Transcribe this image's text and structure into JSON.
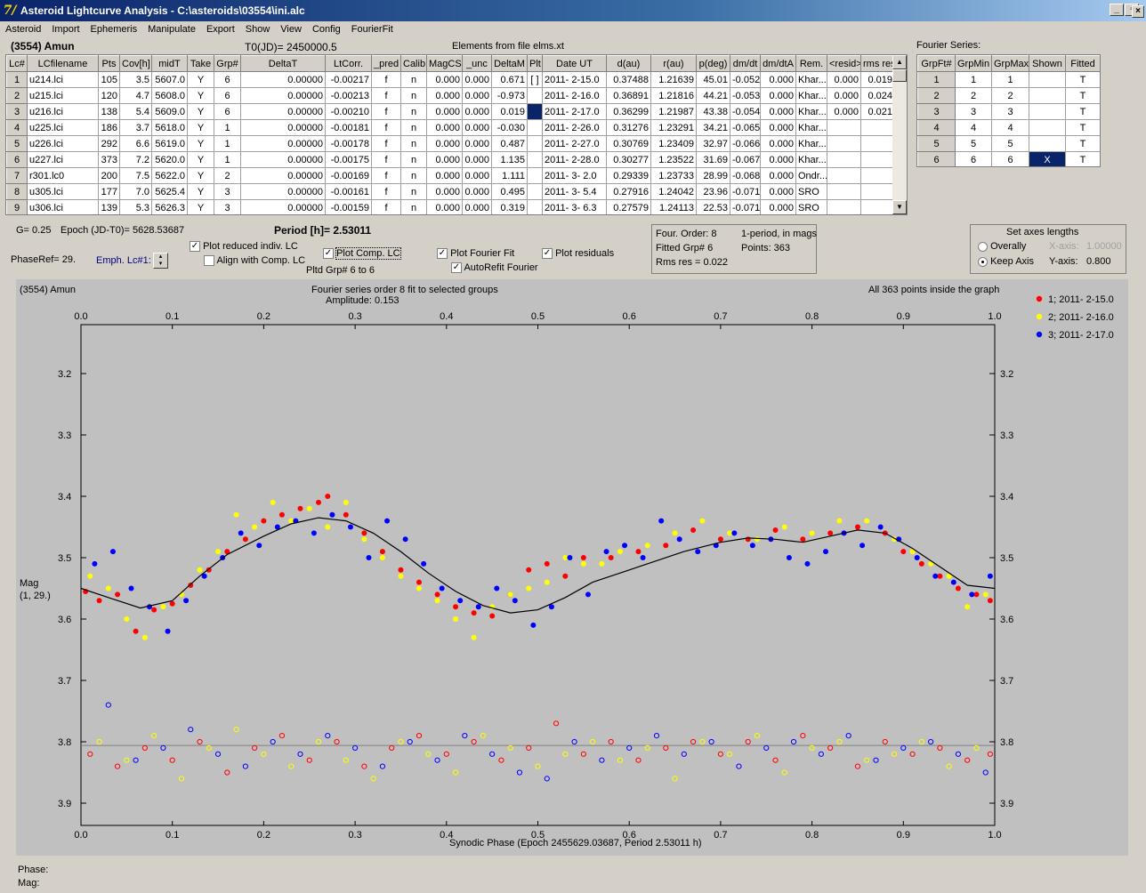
{
  "window": {
    "title": "Asteroid Lightcurve Analysis - C:\\asteroids\\03554\\ini.alc",
    "icon": "app-logo-icon",
    "controls": [
      "minimize-icon",
      "restore-icon",
      "close-icon"
    ]
  },
  "menu": [
    "Asteroid",
    "Import",
    "Ephemeris",
    "Manipulate",
    "Export",
    "Show",
    "View",
    "Config",
    "FourierFit"
  ],
  "header": {
    "asteroid": "(3554) Amun",
    "t0": "T0(JD)= 2450000.5",
    "elements": "Elements from file elms.xt"
  },
  "lc_table": {
    "columns": [
      "Lc#",
      "LCfilename",
      "Pts",
      "Cov[h]",
      "midT",
      "Take",
      "Grp#",
      "DeltaT",
      "LtCorr.",
      "_pred",
      "Calib.",
      "MagCS",
      "_unc",
      "DeltaM",
      "Plt",
      "Date UT",
      "d(au)",
      "r(au)",
      "p(deg)",
      "dm/dt",
      "dm/dtA",
      "Rem.",
      "<resid>",
      "rms res"
    ],
    "rows": [
      [
        "1",
        "u214.lci",
        "105",
        "3.5",
        "5607.0",
        "Y",
        "6",
        "0.00000",
        "-0.00217",
        "f",
        "n",
        "0.000",
        "0.000",
        "0.671",
        "[ ]",
        "2011- 2-15.0",
        "0.37488",
        "1.21639",
        "45.01",
        "-0.052",
        "0.000",
        "Khar...",
        "0.000",
        "0.019"
      ],
      [
        "2",
        "u215.lci",
        "120",
        "4.7",
        "5608.0",
        "Y",
        "6",
        "0.00000",
        "-0.00213",
        "f",
        "n",
        "0.000",
        "0.000",
        "-0.973",
        "",
        "2011- 2-16.0",
        "0.36891",
        "1.21816",
        "44.21",
        "-0.053",
        "0.000",
        "Khar...",
        "0.000",
        "0.024"
      ],
      [
        "3",
        "u216.lci",
        "138",
        "5.4",
        "5609.0",
        "Y",
        "6",
        "0.00000",
        "-0.00210",
        "f",
        "n",
        "0.000",
        "0.000",
        "0.019",
        "",
        "2011- 2-17.0",
        "0.36299",
        "1.21987",
        "43.38",
        "-0.054",
        "0.000",
        "Khar...",
        "0.000",
        "0.021"
      ],
      [
        "4",
        "u225.lci",
        "186",
        "3.7",
        "5618.0",
        "Y",
        "1",
        "0.00000",
        "-0.00181",
        "f",
        "n",
        "0.000",
        "0.000",
        "-0.030",
        "",
        "2011- 2-26.0",
        "0.31276",
        "1.23291",
        "34.21",
        "-0.065",
        "0.000",
        "Khar...",
        "",
        ""
      ],
      [
        "5",
        "u226.lci",
        "292",
        "6.6",
        "5619.0",
        "Y",
        "1",
        "0.00000",
        "-0.00178",
        "f",
        "n",
        "0.000",
        "0.000",
        "0.487",
        "",
        "2011- 2-27.0",
        "0.30769",
        "1.23409",
        "32.97",
        "-0.066",
        "0.000",
        "Khar...",
        "",
        ""
      ],
      [
        "6",
        "u227.lci",
        "373",
        "7.2",
        "5620.0",
        "Y",
        "1",
        "0.00000",
        "-0.00175",
        "f",
        "n",
        "0.000",
        "0.000",
        "1.135",
        "",
        "2011- 2-28.0",
        "0.30277",
        "1.23522",
        "31.69",
        "-0.067",
        "0.000",
        "Khar...",
        "",
        ""
      ],
      [
        "7",
        "r301.lc0",
        "200",
        "7.5",
        "5622.0",
        "Y",
        "2",
        "0.00000",
        "-0.00169",
        "f",
        "n",
        "0.000",
        "0.000",
        "1.111",
        "",
        "2011- 3- 2.0",
        "0.29339",
        "1.23733",
        "28.99",
        "-0.068",
        "0.000",
        "Ondr...",
        "",
        ""
      ],
      [
        "8",
        "u305.lci",
        "177",
        "7.0",
        "5625.4",
        "Y",
        "3",
        "0.00000",
        "-0.00161",
        "f",
        "n",
        "0.000",
        "0.000",
        "0.495",
        "",
        "2011- 3- 5.4",
        "0.27916",
        "1.24042",
        "23.96",
        "-0.071",
        "0.000",
        "SRO",
        "",
        ""
      ],
      [
        "9",
        "u306.lci",
        "139",
        "5.3",
        "5626.3",
        "Y",
        "3",
        "0.00000",
        "-0.00159",
        "f",
        "n",
        "0.000",
        "0.000",
        "0.319",
        "",
        "2011- 3- 6.3",
        "0.27579",
        "1.24113",
        "22.53",
        "-0.071",
        "0.000",
        "SRO",
        "",
        ""
      ]
    ],
    "selected_plt_row": 3
  },
  "fourier": {
    "label": "Fourier Series:",
    "columns": [
      "GrpFt#",
      "GrpMin",
      "GrpMax",
      "Shown",
      "Fitted"
    ],
    "rows": [
      [
        "1",
        "1",
        "1",
        "",
        "T"
      ],
      [
        "2",
        "2",
        "2",
        "",
        "T"
      ],
      [
        "3",
        "3",
        "3",
        "",
        "T"
      ],
      [
        "4",
        "4",
        "4",
        "",
        "T"
      ],
      [
        "5",
        "5",
        "5",
        "",
        "T"
      ],
      [
        "6",
        "6",
        "6",
        "X",
        "T"
      ]
    ]
  },
  "params": {
    "g": "G= 0.25",
    "epoch": "Epoch (JD-T0)= 5628.53687",
    "period": "Period [h]= 2.53011",
    "phaseref": "PhaseRef= 29.",
    "emph": "Emph. Lc#1:",
    "pltd": "Pltd Grp#  6  to   6"
  },
  "checks": [
    {
      "id": "plot-reduced",
      "label": "Plot reduced indiv. LC",
      "checked": true
    },
    {
      "id": "align-comp",
      "label": "Align with Comp. LC",
      "checked": false
    },
    {
      "id": "plot-comp",
      "label": "Plot Comp. LC",
      "checked": true
    },
    {
      "id": "plot-fourier",
      "label": "Plot Fourier Fit",
      "checked": true
    },
    {
      "id": "autorefit",
      "label": "AutoRefit Fourier",
      "checked": true
    },
    {
      "id": "plot-resid",
      "label": "Plot residuals",
      "checked": true
    }
  ],
  "info": {
    "order": "Four. Order:  8",
    "fitted": "Fitted Grp# 6",
    "rms": "Rms res     = 0.022",
    "period_note": "1-period, in mags",
    "points": "Points: 363"
  },
  "axes_box": {
    "title": "Set axes lengths",
    "overally": "Overally",
    "keep": "Keep Axis",
    "xaxis_label": "X-axis:",
    "xaxis_val": "1.00000",
    "yaxis_label": "Y-axis:",
    "yaxis_val": "0.800",
    "selected": "keep"
  },
  "chart_data": {
    "type": "scatter",
    "title": "Fourier series order 8 fit to selected groups",
    "subtitle": "Amplitude: 0.153",
    "left_label": "(3554) Amun",
    "right_label": "All 363 points inside the graph",
    "xlabel": "Synodic Phase (Epoch 2455629.03687, Period 2.53011 h)",
    "ylabel": "Mag\n(1, 29.)",
    "xlim": [
      0,
      1
    ],
    "ylim": [
      3.9,
      3.2
    ],
    "y_inverted": true,
    "xticks": [
      "0.0",
      "0.1",
      "0.2",
      "0.3",
      "0.4",
      "0.5",
      "0.6",
      "0.7",
      "0.8",
      "0.9",
      "1.0"
    ],
    "yticks": [
      "3.2",
      "3.3",
      "3.4",
      "3.5",
      "3.6",
      "3.7",
      "3.8",
      "3.9"
    ],
    "residual_baseline": 3.806,
    "fourier_fit": {
      "x": [
        0,
        0.03,
        0.065,
        0.1,
        0.13,
        0.16,
        0.2,
        0.23,
        0.26,
        0.29,
        0.32,
        0.35,
        0.38,
        0.41,
        0.44,
        0.47,
        0.5,
        0.53,
        0.56,
        0.6,
        0.63,
        0.66,
        0.7,
        0.73,
        0.76,
        0.79,
        0.82,
        0.85,
        0.88,
        0.91,
        0.94,
        0.97,
        1.0
      ],
      "y": [
        3.55,
        3.565,
        3.582,
        3.57,
        3.53,
        3.495,
        3.465,
        3.445,
        3.435,
        3.44,
        3.46,
        3.49,
        3.525,
        3.555,
        3.578,
        3.59,
        3.585,
        3.565,
        3.54,
        3.52,
        3.505,
        3.49,
        3.475,
        3.468,
        3.47,
        3.475,
        3.465,
        3.455,
        3.46,
        3.485,
        3.515,
        3.545,
        3.55
      ]
    },
    "series": [
      {
        "name": "1; 2011- 2-15.0",
        "color": "#ff0000",
        "x": [
          0.005,
          0.02,
          0.04,
          0.06,
          0.08,
          0.1,
          0.12,
          0.14,
          0.16,
          0.18,
          0.2,
          0.22,
          0.24,
          0.26,
          0.27,
          0.29,
          0.31,
          0.33,
          0.35,
          0.37,
          0.39,
          0.41,
          0.43,
          0.45,
          0.47,
          0.49,
          0.51,
          0.53,
          0.55,
          0.58,
          0.61,
          0.64,
          0.67,
          0.7,
          0.73,
          0.76,
          0.79,
          0.82,
          0.85,
          0.88,
          0.9,
          0.92,
          0.94,
          0.96,
          0.98,
          0.995
        ],
        "y": [
          3.555,
          3.57,
          3.56,
          3.62,
          3.585,
          3.575,
          3.545,
          3.52,
          3.49,
          3.47,
          3.44,
          3.43,
          3.42,
          3.41,
          3.4,
          3.43,
          3.46,
          3.49,
          3.52,
          3.54,
          3.56,
          3.58,
          3.59,
          3.595,
          3.56,
          3.52,
          3.51,
          3.53,
          3.5,
          3.5,
          3.49,
          3.48,
          3.455,
          3.47,
          3.47,
          3.455,
          3.47,
          3.46,
          3.45,
          3.46,
          3.49,
          3.51,
          3.53,
          3.55,
          3.56,
          3.57
        ]
      },
      {
        "name": "2; 2011- 2-16.0",
        "color": "#ffff00",
        "x": [
          0.01,
          0.03,
          0.05,
          0.07,
          0.09,
          0.11,
          0.13,
          0.15,
          0.17,
          0.19,
          0.21,
          0.23,
          0.25,
          0.27,
          0.29,
          0.31,
          0.33,
          0.35,
          0.37,
          0.39,
          0.41,
          0.43,
          0.45,
          0.47,
          0.49,
          0.51,
          0.53,
          0.55,
          0.57,
          0.59,
          0.62,
          0.65,
          0.68,
          0.71,
          0.74,
          0.77,
          0.8,
          0.83,
          0.86,
          0.89,
          0.91,
          0.93,
          0.95,
          0.97,
          0.99
        ],
        "y": [
          3.53,
          3.55,
          3.6,
          3.63,
          3.58,
          3.56,
          3.52,
          3.49,
          3.43,
          3.45,
          3.41,
          3.44,
          3.42,
          3.45,
          3.41,
          3.47,
          3.5,
          3.53,
          3.55,
          3.57,
          3.6,
          3.63,
          3.58,
          3.56,
          3.55,
          3.54,
          3.5,
          3.51,
          3.51,
          3.49,
          3.48,
          3.46,
          3.44,
          3.46,
          3.47,
          3.45,
          3.46,
          3.44,
          3.44,
          3.47,
          3.49,
          3.51,
          3.53,
          3.58,
          3.56
        ]
      },
      {
        "name": "3; 2011- 2-17.0",
        "color": "#0000ff",
        "x": [
          0.015,
          0.035,
          0.055,
          0.075,
          0.095,
          0.115,
          0.135,
          0.155,
          0.175,
          0.195,
          0.215,
          0.235,
          0.255,
          0.275,
          0.295,
          0.315,
          0.335,
          0.355,
          0.375,
          0.395,
          0.415,
          0.435,
          0.455,
          0.475,
          0.495,
          0.515,
          0.535,
          0.555,
          0.575,
          0.595,
          0.615,
          0.635,
          0.655,
          0.675,
          0.695,
          0.715,
          0.735,
          0.755,
          0.775,
          0.795,
          0.815,
          0.835,
          0.855,
          0.875,
          0.895,
          0.915,
          0.935,
          0.955,
          0.975,
          0.995
        ],
        "y": [
          3.51,
          3.49,
          3.55,
          3.58,
          3.62,
          3.57,
          3.53,
          3.5,
          3.46,
          3.48,
          3.45,
          3.44,
          3.46,
          3.43,
          3.45,
          3.5,
          3.44,
          3.47,
          3.51,
          3.55,
          3.57,
          3.58,
          3.55,
          3.57,
          3.61,
          3.58,
          3.5,
          3.56,
          3.49,
          3.48,
          3.5,
          3.44,
          3.47,
          3.49,
          3.48,
          3.46,
          3.48,
          3.47,
          3.5,
          3.51,
          3.49,
          3.46,
          3.48,
          3.45,
          3.47,
          3.5,
          3.53,
          3.54,
          3.56,
          3.53
        ]
      }
    ],
    "residuals": {
      "red": {
        "x": [
          0.01,
          0.04,
          0.07,
          0.1,
          0.13,
          0.16,
          0.19,
          0.22,
          0.25,
          0.28,
          0.31,
          0.34,
          0.37,
          0.4,
          0.43,
          0.46,
          0.49,
          0.52,
          0.55,
          0.58,
          0.61,
          0.64,
          0.67,
          0.7,
          0.73,
          0.76,
          0.79,
          0.82,
          0.85,
          0.88,
          0.91,
          0.94,
          0.97,
          0.995
        ],
        "y": [
          3.82,
          3.84,
          3.81,
          3.83,
          3.8,
          3.85,
          3.81,
          3.79,
          3.83,
          3.8,
          3.84,
          3.81,
          3.79,
          3.82,
          3.8,
          3.83,
          3.81,
          3.77,
          3.82,
          3.8,
          3.83,
          3.81,
          3.8,
          3.82,
          3.8,
          3.83,
          3.79,
          3.81,
          3.84,
          3.8,
          3.82,
          3.81,
          3.83,
          3.82
        ]
      },
      "yellow": {
        "x": [
          0.02,
          0.05,
          0.08,
          0.11,
          0.14,
          0.17,
          0.2,
          0.23,
          0.26,
          0.29,
          0.32,
          0.35,
          0.38,
          0.41,
          0.44,
          0.47,
          0.5,
          0.53,
          0.56,
          0.59,
          0.62,
          0.65,
          0.68,
          0.71,
          0.74,
          0.77,
          0.8,
          0.83,
          0.86,
          0.89,
          0.92,
          0.95,
          0.98
        ],
        "y": [
          3.8,
          3.83,
          3.79,
          3.86,
          3.81,
          3.78,
          3.82,
          3.84,
          3.8,
          3.83,
          3.86,
          3.8,
          3.82,
          3.85,
          3.79,
          3.81,
          3.84,
          3.82,
          3.8,
          3.83,
          3.81,
          3.86,
          3.8,
          3.82,
          3.79,
          3.85,
          3.81,
          3.8,
          3.83,
          3.82,
          3.8,
          3.84,
          3.81
        ]
      },
      "blue": {
        "x": [
          0.03,
          0.06,
          0.09,
          0.12,
          0.15,
          0.18,
          0.21,
          0.24,
          0.27,
          0.3,
          0.33,
          0.36,
          0.39,
          0.42,
          0.45,
          0.48,
          0.51,
          0.54,
          0.57,
          0.6,
          0.63,
          0.66,
          0.69,
          0.72,
          0.75,
          0.78,
          0.81,
          0.84,
          0.87,
          0.9,
          0.93,
          0.96,
          0.99
        ],
        "y": [
          3.74,
          3.83,
          3.81,
          3.78,
          3.82,
          3.84,
          3.8,
          3.82,
          3.79,
          3.81,
          3.84,
          3.8,
          3.83,
          3.79,
          3.82,
          3.85,
          3.86,
          3.8,
          3.83,
          3.81,
          3.79,
          3.82,
          3.8,
          3.84,
          3.81,
          3.8,
          3.82,
          3.79,
          3.83,
          3.81,
          3.8,
          3.82,
          3.85
        ]
      }
    }
  },
  "status": {
    "phase": "Phase:",
    "mag": "Mag:"
  }
}
